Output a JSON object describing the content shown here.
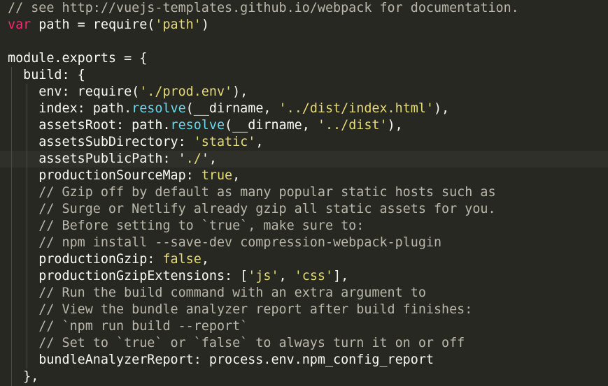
{
  "editor": {
    "lines": [
      {
        "tokens": [
          {
            "t": "// see http://vuejs-templates.github.io/webpack for documentation.",
            "c": "comment"
          }
        ]
      },
      {
        "tokens": [
          {
            "t": "var",
            "c": "keyword"
          },
          {
            "t": " path = require(",
            "c": "plain"
          },
          {
            "t": "'path'",
            "c": "string"
          },
          {
            "t": ")",
            "c": "plain"
          }
        ]
      },
      {
        "tokens": []
      },
      {
        "tokens": [
          {
            "t": "module.exports = {",
            "c": "plain"
          }
        ]
      },
      {
        "tokens": [
          {
            "t": "  build: {",
            "c": "plain"
          }
        ]
      },
      {
        "tokens": [
          {
            "t": "    env: require(",
            "c": "plain"
          },
          {
            "t": "'./prod.env'",
            "c": "string"
          },
          {
            "t": "),",
            "c": "plain"
          }
        ]
      },
      {
        "tokens": [
          {
            "t": "    index: path.",
            "c": "plain"
          },
          {
            "t": "resolve",
            "c": "method"
          },
          {
            "t": "(__dirname, ",
            "c": "plain"
          },
          {
            "t": "'../dist/index.html'",
            "c": "string"
          },
          {
            "t": "),",
            "c": "plain"
          }
        ]
      },
      {
        "tokens": [
          {
            "t": "    assetsRoot: path.",
            "c": "plain"
          },
          {
            "t": "resolve",
            "c": "method"
          },
          {
            "t": "(__dirname, ",
            "c": "plain"
          },
          {
            "t": "'../dist'",
            "c": "string"
          },
          {
            "t": "),",
            "c": "plain"
          }
        ]
      },
      {
        "tokens": [
          {
            "t": "    assetsSubDirectory: ",
            "c": "plain"
          },
          {
            "t": "'static'",
            "c": "string"
          },
          {
            "t": ",",
            "c": "plain"
          }
        ]
      },
      {
        "tokens": [
          {
            "t": "    assetsPublicPath: ",
            "c": "plain"
          },
          {
            "t": "'",
            "c": "match"
          },
          {
            "t": "./",
            "c": "string"
          },
          {
            "t": "'",
            "c": "match"
          },
          {
            "t": ",",
            "c": "plain"
          }
        ]
      },
      {
        "tokens": [
          {
            "t": "    productionSourceMap: ",
            "c": "plain"
          },
          {
            "t": "true",
            "c": "bool"
          },
          {
            "t": ",",
            "c": "plain"
          }
        ]
      },
      {
        "tokens": [
          {
            "t": "    // Gzip off by default as many popular static hosts such as",
            "c": "comment"
          }
        ]
      },
      {
        "tokens": [
          {
            "t": "    // Surge or Netlify already gzip all static assets for you.",
            "c": "comment"
          }
        ]
      },
      {
        "tokens": [
          {
            "t": "    // Before setting to `true`, make sure to:",
            "c": "comment"
          }
        ]
      },
      {
        "tokens": [
          {
            "t": "    // npm install --save-dev compression-webpack-plugin",
            "c": "comment"
          }
        ]
      },
      {
        "tokens": [
          {
            "t": "    productionGzip: ",
            "c": "plain"
          },
          {
            "t": "false",
            "c": "bool"
          },
          {
            "t": ",",
            "c": "plain"
          }
        ]
      },
      {
        "tokens": [
          {
            "t": "    productionGzipExtensions: [",
            "c": "plain"
          },
          {
            "t": "'js'",
            "c": "string"
          },
          {
            "t": ", ",
            "c": "plain"
          },
          {
            "t": "'css'",
            "c": "string"
          },
          {
            "t": "],",
            "c": "plain"
          }
        ]
      },
      {
        "tokens": [
          {
            "t": "    // Run the build command with an extra argument to",
            "c": "comment"
          }
        ]
      },
      {
        "tokens": [
          {
            "t": "    // View the bundle analyzer report after build finishes:",
            "c": "comment"
          }
        ]
      },
      {
        "tokens": [
          {
            "t": "    // `npm run build --report`",
            "c": "comment"
          }
        ]
      },
      {
        "tokens": [
          {
            "t": "    // Set to `true` or `false` to always turn it on or off",
            "c": "comment"
          }
        ]
      },
      {
        "tokens": [
          {
            "t": "    bundleAnalyzerReport: process.env.npm_config_report",
            "c": "plain"
          }
        ]
      },
      {
        "tokens": [
          {
            "t": "  },",
            "c": "plain"
          }
        ]
      }
    ]
  }
}
